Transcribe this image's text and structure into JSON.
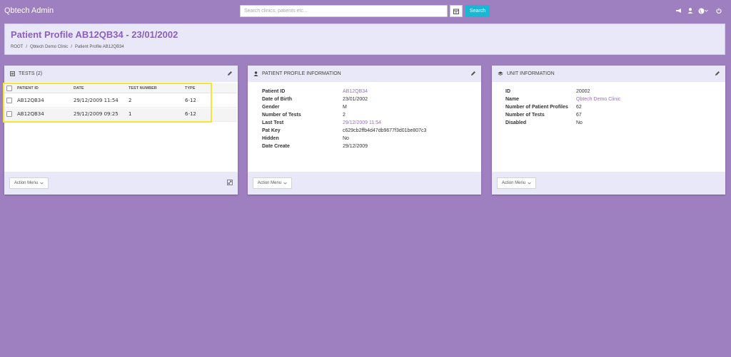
{
  "app": {
    "title": "Qbtech Admin"
  },
  "search": {
    "placeholder": "Search clinics, patients etc...",
    "button_label": "Search"
  },
  "colors": {
    "background": "#9e7fc0",
    "accent": "#8a5fc0",
    "search_button": "#1ab7d4",
    "highlight": "#f5e634"
  },
  "header": {
    "title": "Patient Profile AB12QB34 - 23/01/2002",
    "breadcrumb": [
      "ROOT",
      "/",
      "Qbtech Demo Clinic",
      "/",
      "Patient Profile AB12QB34"
    ]
  },
  "tests_panel": {
    "title": "TESTS (2)",
    "columns": [
      "PATIENT ID",
      "DATE",
      "TEST NUMBER",
      "TYPE"
    ],
    "rows": [
      {
        "patient_id": "AB12QB34",
        "date": "29/12/2009 11:54",
        "test_number": "2",
        "type": "6-12"
      },
      {
        "patient_id": "AB12QB34",
        "date": "29/12/2009 09:25",
        "test_number": "1",
        "type": "6-12"
      }
    ],
    "action_menu": "Action Menu"
  },
  "profile_panel": {
    "title": "PATIENT PROFILE INFORMATION",
    "fields": [
      {
        "label": "Patient ID",
        "value": "AB12QB34"
      },
      {
        "label": "Date of Birth",
        "value": "23/01/2002"
      },
      {
        "label": "Gender",
        "value": "M"
      },
      {
        "label": "Number of Tests",
        "value": "2"
      },
      {
        "label": "Last Test",
        "value": "29/12/2009 11:54"
      },
      {
        "label": "Pat Key",
        "value": "c629cb2ffb4d47db9677f3d01be807c3"
      },
      {
        "label": "Hidden",
        "value": "No"
      },
      {
        "label": "Date Create",
        "value": "29/12/2009"
      }
    ],
    "action_menu": "Action Menu"
  },
  "unit_panel": {
    "title": "UNIT INFORMATION",
    "fields": [
      {
        "label": "ID",
        "value": "20002"
      },
      {
        "label": "Name",
        "value": "Qbtech Demo Clinic"
      },
      {
        "label": "Number of Patient Profiles",
        "value": "62"
      },
      {
        "label": "Number of Tests",
        "value": "67"
      },
      {
        "label": "Disabled",
        "value": "No"
      }
    ],
    "action_menu": "Action Menu"
  }
}
